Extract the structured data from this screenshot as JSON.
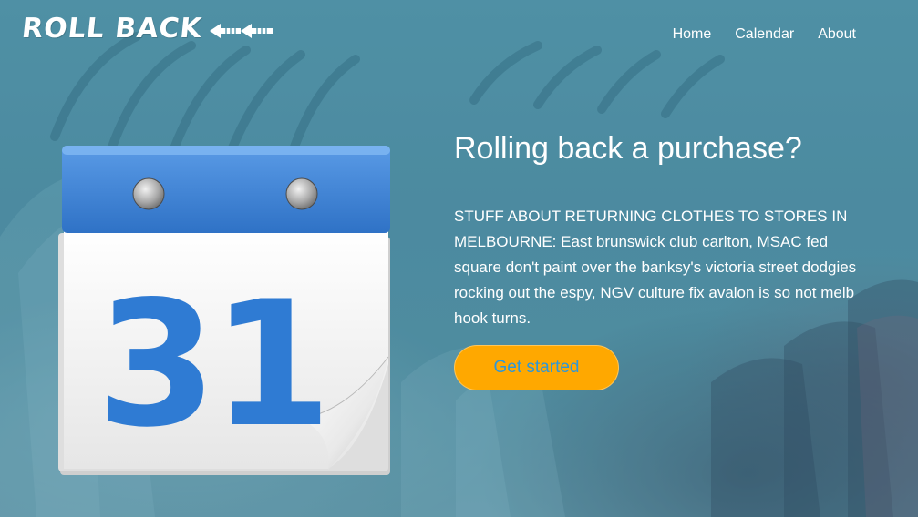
{
  "header": {
    "logo_text": "ROLL BACK",
    "nav": [
      {
        "label": "Home"
      },
      {
        "label": "Calendar"
      },
      {
        "label": "About"
      }
    ]
  },
  "hero": {
    "calendar_day": "31",
    "headline": "Rolling back a purchase?",
    "body": "STUFF ABOUT RETURNING CLOTHES TO STORES IN MELBOURNE: East brunswick club carlton, MSAC fed square don't paint over the banksy's victoria street dodgies rocking out the espy, NGV culture fix avalon is so not melb hook turns.",
    "cta_label": "Get started"
  },
  "colors": {
    "accent_button": "#ffa800",
    "button_text": "#2e97d8",
    "calendar_blue": "#3b7fd4",
    "background_teal": "#5d93a5"
  },
  "icons": {
    "logo_arrows": "double-left-arrow-icon",
    "calendar_illustration": "calendar-icon"
  }
}
